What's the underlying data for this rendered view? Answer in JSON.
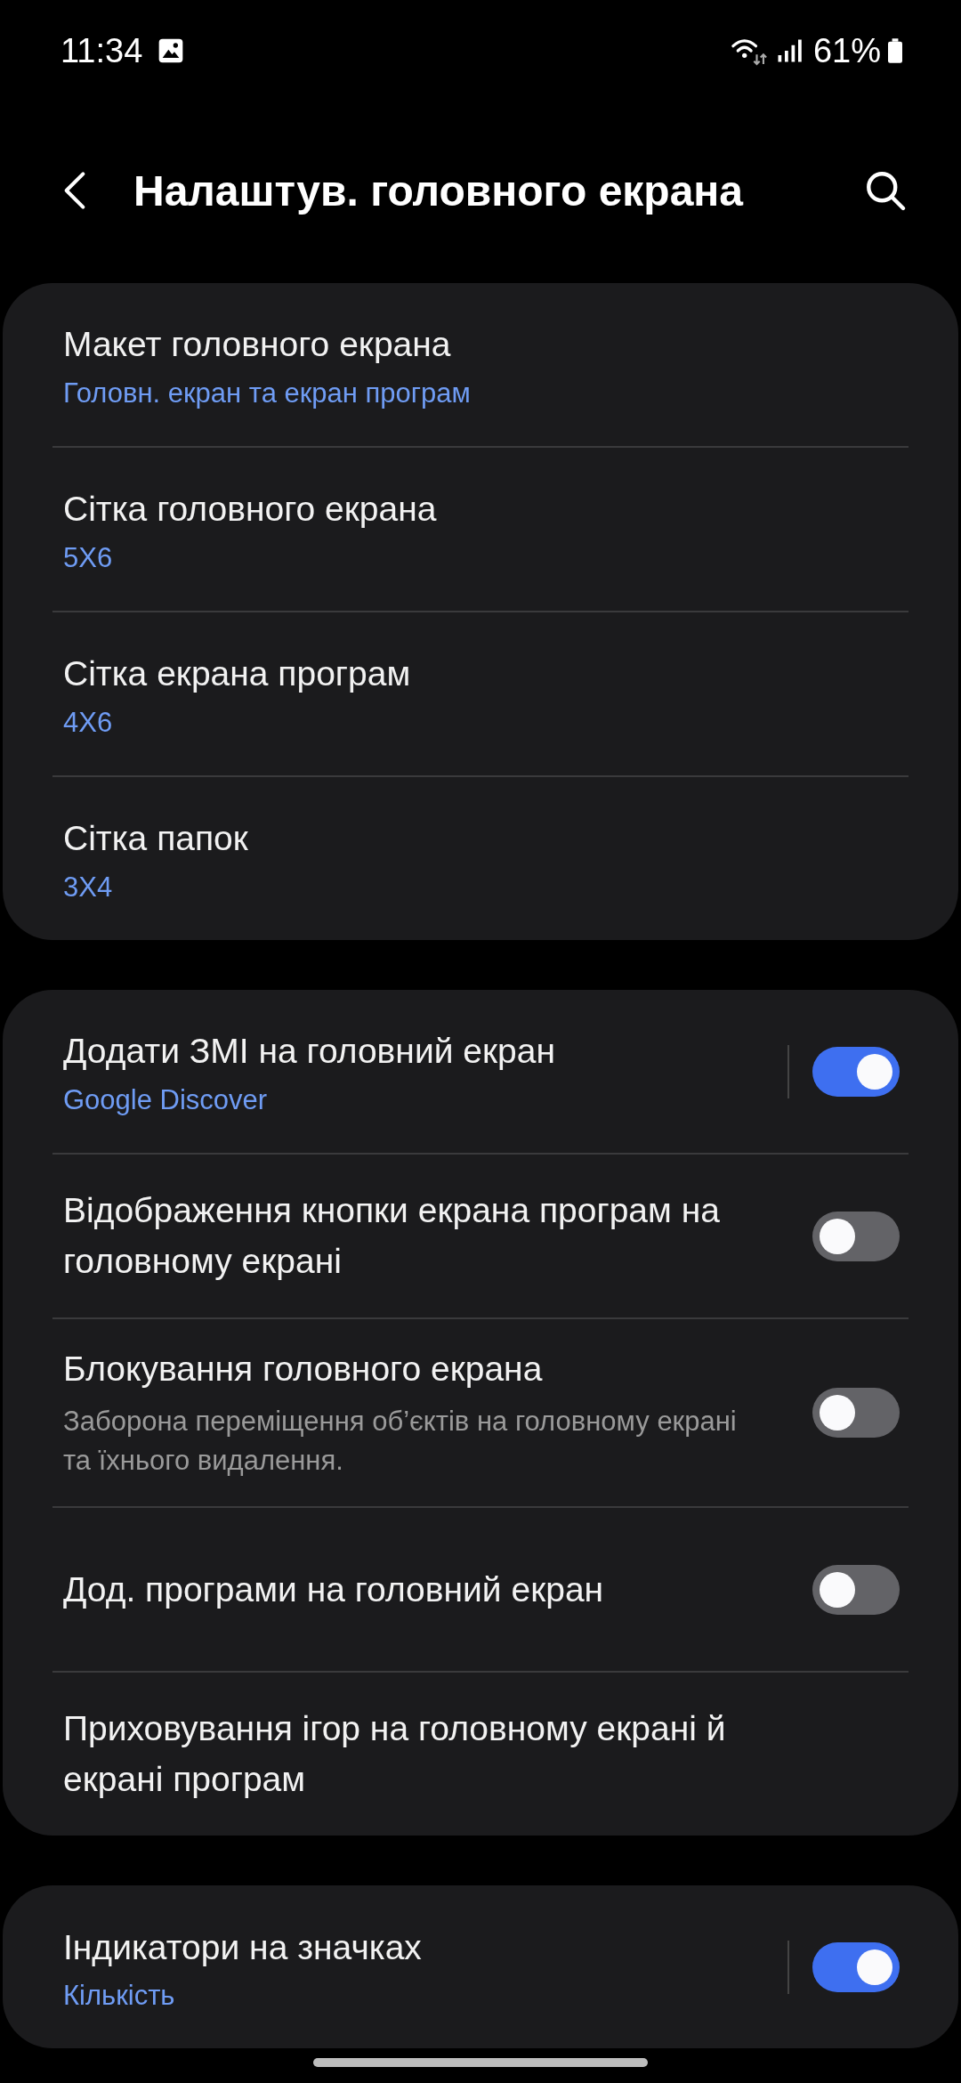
{
  "status_bar": {
    "time": "11:34",
    "battery": "61%"
  },
  "header": {
    "title": "Налаштув. головного екрана"
  },
  "groups": [
    {
      "rows": [
        {
          "kind": "text",
          "title": "Макет головного екрана",
          "value": "Головн. екран та екран програм"
        },
        {
          "kind": "text",
          "title": "Сітка головного екрана",
          "value": "5X6"
        },
        {
          "kind": "text",
          "title": "Сітка екрана програм",
          "value": "4X6"
        },
        {
          "kind": "text",
          "title": "Сітка папок",
          "value": "3X4"
        }
      ]
    },
    {
      "rows": [
        {
          "kind": "split-switch",
          "title": "Додати ЗМІ на головний екран",
          "value": "Google Discover",
          "on": true
        },
        {
          "kind": "switch",
          "title": "Відображення кнопки екрана програм на головному екрані",
          "on": false
        },
        {
          "kind": "switch",
          "title": "Блокування головного екрана",
          "description": "Заборона переміщення об’єктів на головному екрані та їхнього видалення.",
          "on": false
        },
        {
          "kind": "switch",
          "title": "Дод. програми на головний екран",
          "on": false
        },
        {
          "kind": "text",
          "title": "Приховування ігор на головному екрані й екрані програм"
        }
      ]
    },
    {
      "rows": [
        {
          "kind": "split-switch",
          "title": "Індикатори на значках",
          "value": "Кількість",
          "on": true
        }
      ]
    }
  ]
}
